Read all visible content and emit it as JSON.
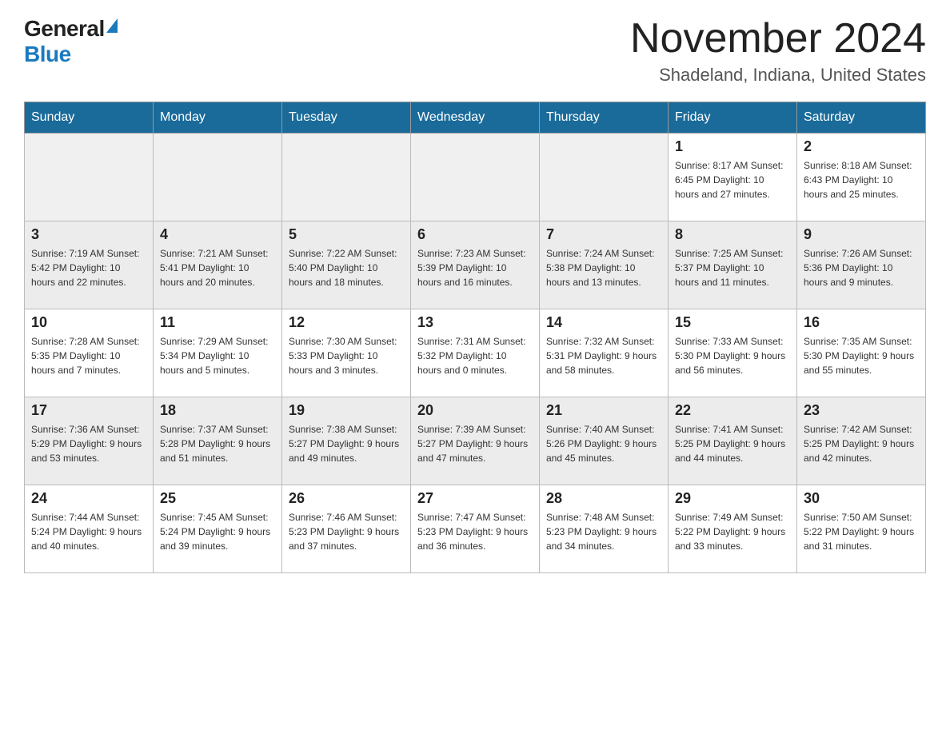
{
  "header": {
    "logo_general": "General",
    "logo_blue": "Blue",
    "main_title": "November 2024",
    "subtitle": "Shadeland, Indiana, United States"
  },
  "days_of_week": [
    "Sunday",
    "Monday",
    "Tuesday",
    "Wednesday",
    "Thursday",
    "Friday",
    "Saturday"
  ],
  "weeks": [
    {
      "days": [
        {
          "number": "",
          "info": ""
        },
        {
          "number": "",
          "info": ""
        },
        {
          "number": "",
          "info": ""
        },
        {
          "number": "",
          "info": ""
        },
        {
          "number": "",
          "info": ""
        },
        {
          "number": "1",
          "info": "Sunrise: 8:17 AM\nSunset: 6:45 PM\nDaylight: 10 hours and 27 minutes."
        },
        {
          "number": "2",
          "info": "Sunrise: 8:18 AM\nSunset: 6:43 PM\nDaylight: 10 hours and 25 minutes."
        }
      ]
    },
    {
      "days": [
        {
          "number": "3",
          "info": "Sunrise: 7:19 AM\nSunset: 5:42 PM\nDaylight: 10 hours and 22 minutes."
        },
        {
          "number": "4",
          "info": "Sunrise: 7:21 AM\nSunset: 5:41 PM\nDaylight: 10 hours and 20 minutes."
        },
        {
          "number": "5",
          "info": "Sunrise: 7:22 AM\nSunset: 5:40 PM\nDaylight: 10 hours and 18 minutes."
        },
        {
          "number": "6",
          "info": "Sunrise: 7:23 AM\nSunset: 5:39 PM\nDaylight: 10 hours and 16 minutes."
        },
        {
          "number": "7",
          "info": "Sunrise: 7:24 AM\nSunset: 5:38 PM\nDaylight: 10 hours and 13 minutes."
        },
        {
          "number": "8",
          "info": "Sunrise: 7:25 AM\nSunset: 5:37 PM\nDaylight: 10 hours and 11 minutes."
        },
        {
          "number": "9",
          "info": "Sunrise: 7:26 AM\nSunset: 5:36 PM\nDaylight: 10 hours and 9 minutes."
        }
      ]
    },
    {
      "days": [
        {
          "number": "10",
          "info": "Sunrise: 7:28 AM\nSunset: 5:35 PM\nDaylight: 10 hours and 7 minutes."
        },
        {
          "number": "11",
          "info": "Sunrise: 7:29 AM\nSunset: 5:34 PM\nDaylight: 10 hours and 5 minutes."
        },
        {
          "number": "12",
          "info": "Sunrise: 7:30 AM\nSunset: 5:33 PM\nDaylight: 10 hours and 3 minutes."
        },
        {
          "number": "13",
          "info": "Sunrise: 7:31 AM\nSunset: 5:32 PM\nDaylight: 10 hours and 0 minutes."
        },
        {
          "number": "14",
          "info": "Sunrise: 7:32 AM\nSunset: 5:31 PM\nDaylight: 9 hours and 58 minutes."
        },
        {
          "number": "15",
          "info": "Sunrise: 7:33 AM\nSunset: 5:30 PM\nDaylight: 9 hours and 56 minutes."
        },
        {
          "number": "16",
          "info": "Sunrise: 7:35 AM\nSunset: 5:30 PM\nDaylight: 9 hours and 55 minutes."
        }
      ]
    },
    {
      "days": [
        {
          "number": "17",
          "info": "Sunrise: 7:36 AM\nSunset: 5:29 PM\nDaylight: 9 hours and 53 minutes."
        },
        {
          "number": "18",
          "info": "Sunrise: 7:37 AM\nSunset: 5:28 PM\nDaylight: 9 hours and 51 minutes."
        },
        {
          "number": "19",
          "info": "Sunrise: 7:38 AM\nSunset: 5:27 PM\nDaylight: 9 hours and 49 minutes."
        },
        {
          "number": "20",
          "info": "Sunrise: 7:39 AM\nSunset: 5:27 PM\nDaylight: 9 hours and 47 minutes."
        },
        {
          "number": "21",
          "info": "Sunrise: 7:40 AM\nSunset: 5:26 PM\nDaylight: 9 hours and 45 minutes."
        },
        {
          "number": "22",
          "info": "Sunrise: 7:41 AM\nSunset: 5:25 PM\nDaylight: 9 hours and 44 minutes."
        },
        {
          "number": "23",
          "info": "Sunrise: 7:42 AM\nSunset: 5:25 PM\nDaylight: 9 hours and 42 minutes."
        }
      ]
    },
    {
      "days": [
        {
          "number": "24",
          "info": "Sunrise: 7:44 AM\nSunset: 5:24 PM\nDaylight: 9 hours and 40 minutes."
        },
        {
          "number": "25",
          "info": "Sunrise: 7:45 AM\nSunset: 5:24 PM\nDaylight: 9 hours and 39 minutes."
        },
        {
          "number": "26",
          "info": "Sunrise: 7:46 AM\nSunset: 5:23 PM\nDaylight: 9 hours and 37 minutes."
        },
        {
          "number": "27",
          "info": "Sunrise: 7:47 AM\nSunset: 5:23 PM\nDaylight: 9 hours and 36 minutes."
        },
        {
          "number": "28",
          "info": "Sunrise: 7:48 AM\nSunset: 5:23 PM\nDaylight: 9 hours and 34 minutes."
        },
        {
          "number": "29",
          "info": "Sunrise: 7:49 AM\nSunset: 5:22 PM\nDaylight: 9 hours and 33 minutes."
        },
        {
          "number": "30",
          "info": "Sunrise: 7:50 AM\nSunset: 5:22 PM\nDaylight: 9 hours and 31 minutes."
        }
      ]
    }
  ]
}
